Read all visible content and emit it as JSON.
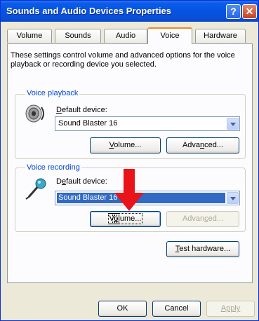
{
  "window": {
    "title": "Sounds and Audio Devices Properties",
    "help_label": "?",
    "close_label": "✕"
  },
  "tabs": [
    {
      "label": "Volume",
      "active": false
    },
    {
      "label": "Sounds",
      "active": false
    },
    {
      "label": "Audio",
      "active": false
    },
    {
      "label": "Voice",
      "active": true
    },
    {
      "label": "Hardware",
      "active": false
    }
  ],
  "description": "These settings control volume and advanced options for the voice playback or recording device you selected.",
  "playback": {
    "legend": "Voice playback",
    "device_label_underlined": "D",
    "device_label_rest": "efault device:",
    "device_value": "Sound Blaster 16",
    "volume_underlined": "V",
    "volume_rest": "olume...",
    "advanced_pre": "Adva",
    "advanced_underlined": "n",
    "advanced_post": "ced..."
  },
  "recording": {
    "legend": "Voice recording",
    "device_label_pre": "D",
    "device_label_underlined": "e",
    "device_label_post": "fault device:",
    "device_value": "Sound Blaster 16",
    "volume_pre": "V",
    "volume_underlined": "o",
    "volume_post": "lume...",
    "advanced_pre": "Advan",
    "advanced_underlined": "c",
    "advanced_post": "ed..."
  },
  "test_hardware": {
    "underlined": "T",
    "rest": "est hardware..."
  },
  "footer": {
    "ok_label": "OK",
    "cancel_label": "Cancel",
    "apply_label": "Apply"
  },
  "colors": {
    "titlebar": "#0553e3",
    "selection": "#316ac5",
    "annotation_arrow": "#e8141a"
  }
}
